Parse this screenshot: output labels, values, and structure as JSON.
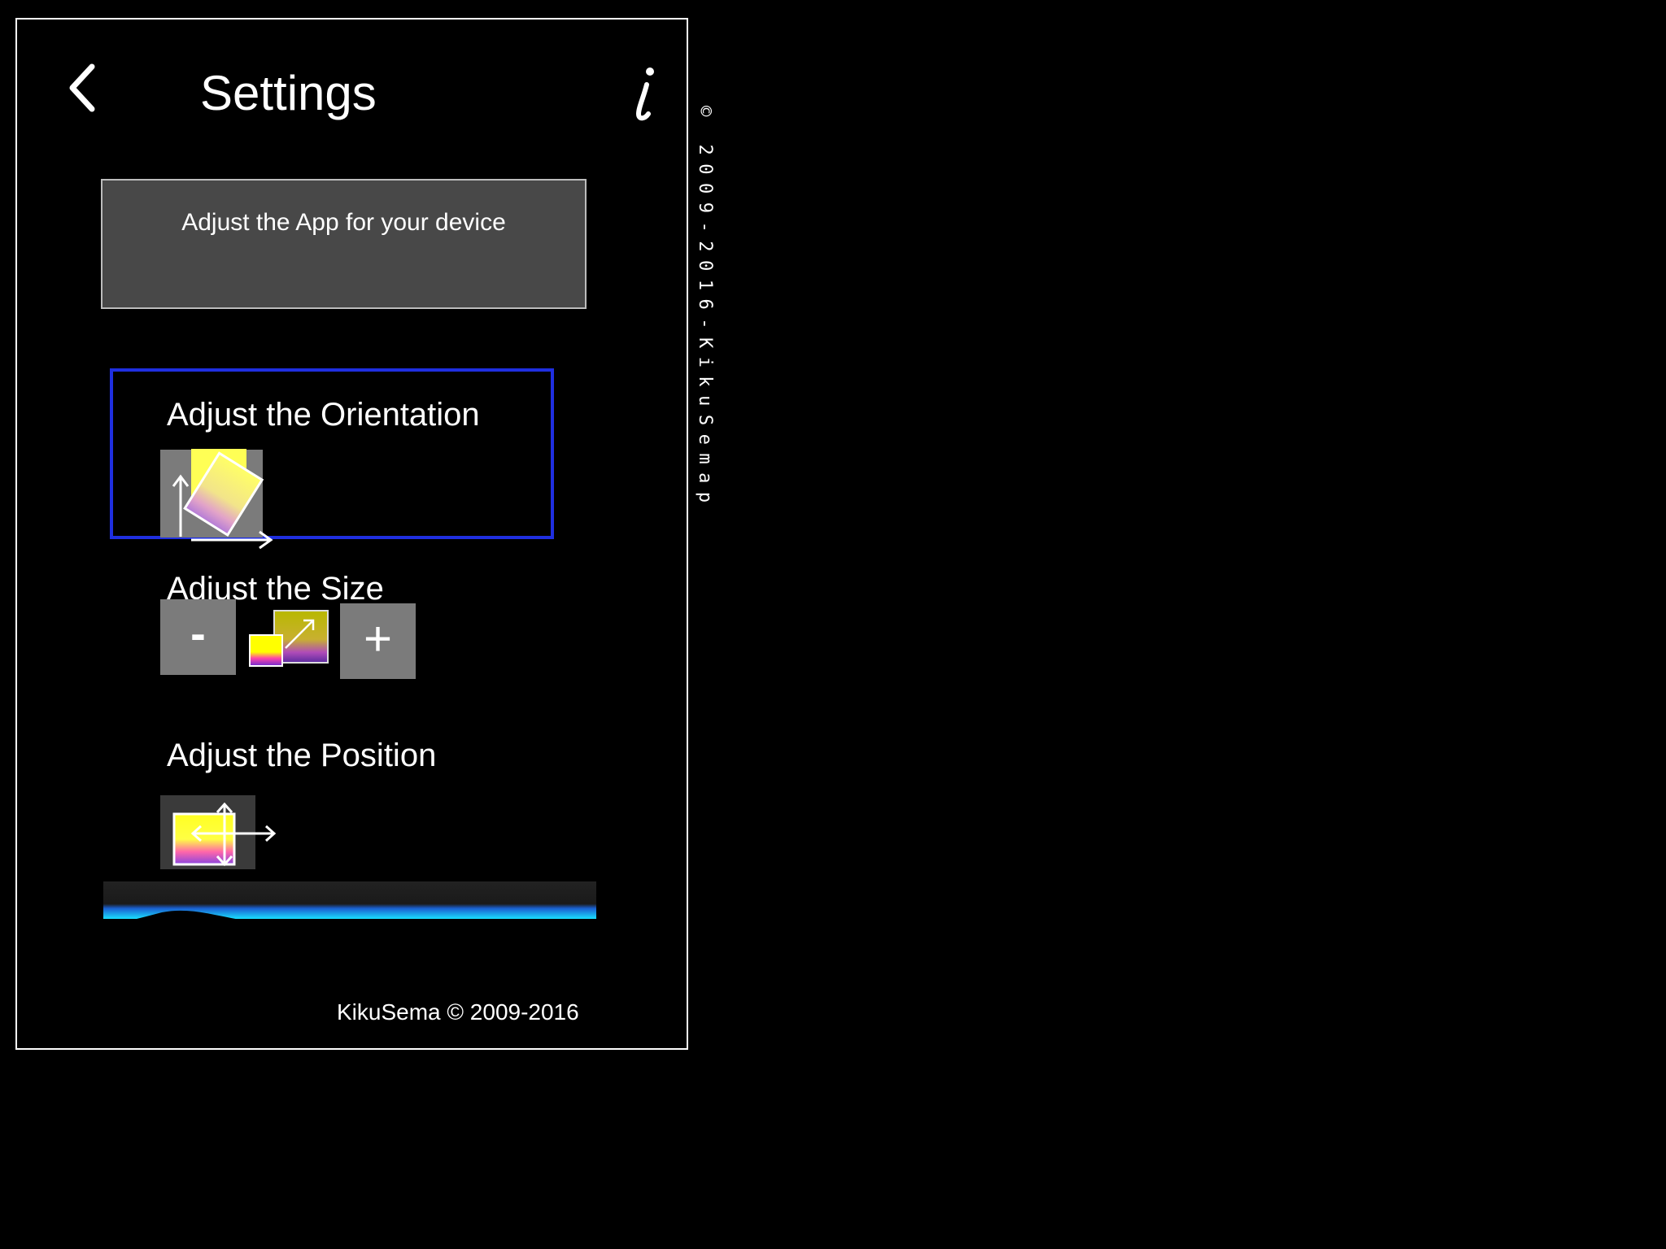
{
  "header": {
    "title": "Settings",
    "back_icon": "chevron-left-icon",
    "info_label": "i"
  },
  "device_box": {
    "label": "Adjust the App for your device"
  },
  "orientation": {
    "label": "Adjust the Orientation",
    "icon": "rotate-icon"
  },
  "size": {
    "label": "Adjust the Size",
    "minus_label": "-",
    "plus_label": "+",
    "icon": "resize-icon"
  },
  "position": {
    "label": "Adjust the Position",
    "icon": "move-icon"
  },
  "footer": {
    "text": "KikuSema © 2009-2016"
  },
  "side_copyright": "© 2009-2016-KikuSemap",
  "colors": {
    "background": "#000000",
    "device_box": "#484848",
    "selection_border": "#1f2fe0",
    "control_gray": "#7b7b7b",
    "horizon_cyan": "#1ad6ff"
  }
}
